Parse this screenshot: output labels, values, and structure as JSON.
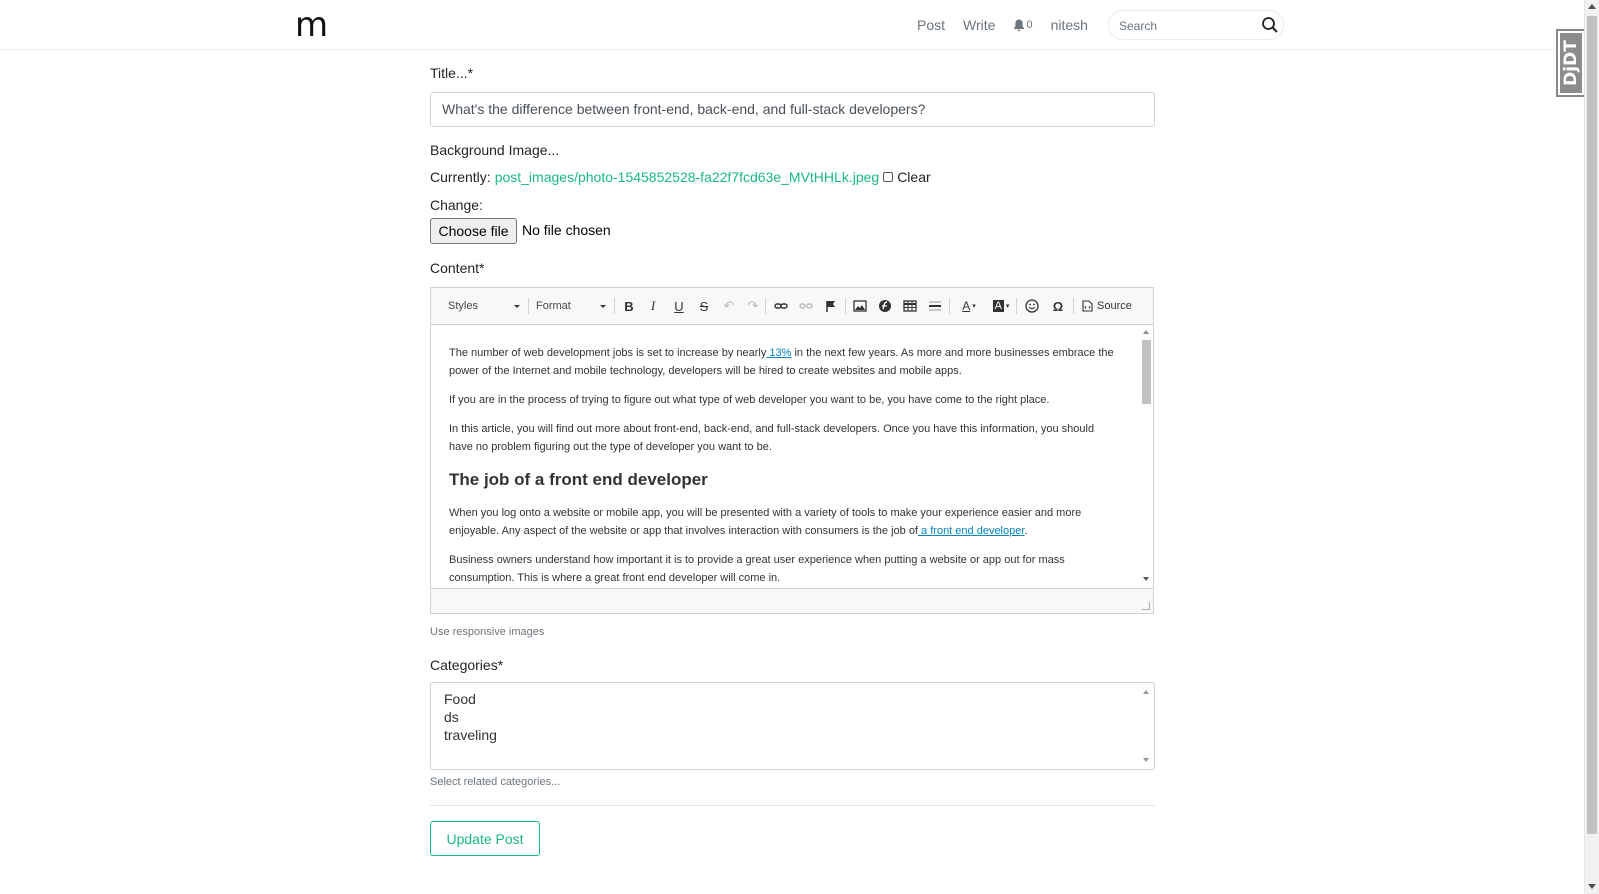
{
  "navbar": {
    "brand": "m",
    "links": {
      "post": "Post",
      "write": "Write",
      "notifications_count": "0",
      "user": "nitesh"
    },
    "search": {
      "placeholder": "Search"
    }
  },
  "debug_toolbar": {
    "label": "DjDT"
  },
  "form": {
    "title_label": "Title...*",
    "title_value": "What's the difference between front-end, back-end, and full-stack developers?",
    "background_label": "Background Image...",
    "currently_label": "Currently:",
    "current_file": "post_images/photo-1545852528-fa22f7fcd63e_MVtHHLk.jpeg",
    "clear_label": "Clear",
    "change_label": "Change:",
    "choose_file_button": "Choose file",
    "no_file_text": "No file chosen",
    "content_label": "Content*",
    "content_help": "Use responsive images",
    "categories_label": "Categories*",
    "categories": [
      "Food",
      "ds",
      "traveling"
    ],
    "categories_help": "Select related categories...",
    "submit_button": "Update Post"
  },
  "editor": {
    "toolbar": {
      "styles": "Styles",
      "format": "Format",
      "source": "Source",
      "icons": [
        "bold-icon",
        "italic-icon",
        "underline-icon",
        "strikethrough-icon",
        "undo-icon",
        "redo-icon",
        "link-icon",
        "unlink-icon",
        "anchor-flag-icon",
        "image-icon",
        "flash-icon",
        "table-icon",
        "horizontal-rule-icon",
        "text-color-icon",
        "background-color-icon",
        "smiley-icon",
        "special-char-icon",
        "source-icon"
      ]
    },
    "content": {
      "p1_before": "The number of web development jobs is set to increase by nearly",
      "p1_link": " 13%",
      "p1_after": " in the next few years. As more and more businesses embrace the power of the Internet and mobile technology, developers will be hired to create websites and mobile apps.",
      "p2": "If you are in the process of trying to figure out what type of web developer you want to be, you have come to the right place.",
      "p3": "In this article, you will find out more about front-end, back-end, and full-stack developers. Once you have this information, you should have no problem figuring out the type of developer you want to be.",
      "h2": "The job of a front end developer",
      "p4_before": "When you log onto a website or mobile app, you will be presented with a variety of tools to make your experience easier and more enjoyable. Any aspect of the website or app that involves interaction with consumers is the job of",
      "p4_link": " a front end developer",
      "p4_after": ".",
      "p5": "Business owners understand how important it is to provide a great user experience when putting a website or app out for mass consumption. This is where a great front end developer will come in."
    }
  },
  "colors": {
    "accent": "#1bb884",
    "link": "#0782c1",
    "muted": "#6c757d"
  }
}
